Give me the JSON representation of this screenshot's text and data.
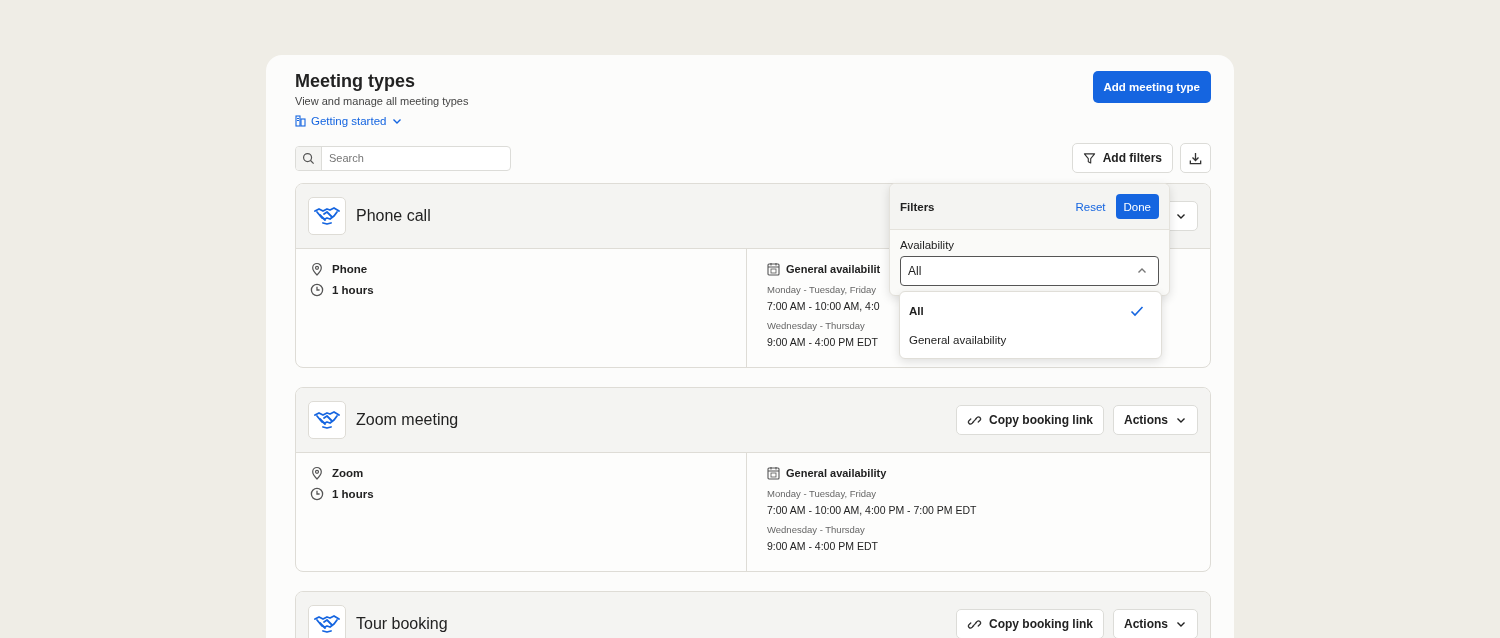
{
  "header": {
    "title": "Meeting types",
    "subtitle": "View and manage all meeting types",
    "guide_link": "Getting started",
    "add_button": "Add meeting type"
  },
  "toolbar": {
    "search_placeholder": "Search",
    "filter_button": "Add filters"
  },
  "meeting_types": [
    {
      "name": "Phone call",
      "has_actions": true,
      "location": "Phone",
      "duration": "1 hours",
      "availability_title": "General availabilit",
      "schedule": [
        {
          "days": "Monday - Tuesday, Friday",
          "hours": "7:00 AM - 10:00 AM, 4:0"
        },
        {
          "days": "Wednesday - Thursday",
          "hours": "9:00 AM - 4:00 PM EDT"
        }
      ]
    },
    {
      "name": "Zoom meeting",
      "copy_link": "Copy booking link",
      "has_actions": true,
      "actions_label": "Actions",
      "location": "Zoom",
      "duration": "1 hours",
      "availability_title": "General availability",
      "schedule": [
        {
          "days": "Monday - Tuesday, Friday",
          "hours": "7:00 AM - 10:00 AM, 4:00 PM - 7:00 PM EDT"
        },
        {
          "days": "Wednesday - Thursday",
          "hours": "9:00 AM - 4:00 PM EDT"
        }
      ]
    },
    {
      "name": "Tour booking",
      "copy_link": "Copy booking link",
      "has_actions": true,
      "actions_label": "Actions"
    }
  ],
  "filter_popover": {
    "title": "Filters",
    "reset": "Reset",
    "done": "Done",
    "field_label": "Availability",
    "value": "All",
    "expanded": true,
    "options": [
      {
        "label": "All",
        "selected": true
      },
      {
        "label": "General availability",
        "selected": false
      }
    ]
  }
}
